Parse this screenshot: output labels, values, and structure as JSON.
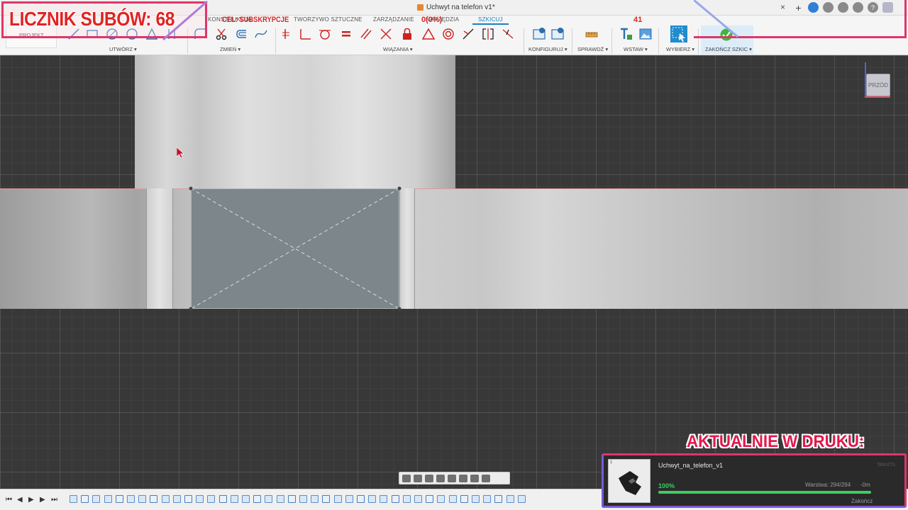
{
  "document": {
    "title": "Uchwyt na telefon v1*",
    "close_glyph": "×"
  },
  "ribbon": {
    "project_label": "PROJEKT",
    "tabs": [
      {
        "label": "KONSTRUKCJA"
      },
      {
        "label": "TWORZYWO SZTUCZNE"
      },
      {
        "label": "ZARZĄDZANIE"
      },
      {
        "label": "NARZĘDZIA"
      },
      {
        "label": "SZKICUJ",
        "active": true
      }
    ],
    "groups": {
      "create": "UTWÓRZ",
      "modify": "ZMIEŃ",
      "constraints": "WIĄZANIA",
      "configure": "KONFIGURUJ",
      "inspect": "SPRAWDŹ",
      "insert": "WSTAW",
      "select": "WYBIERZ",
      "finish_sketch": "ZAKOŃCZ SZKIC"
    }
  },
  "viewcube": {
    "face": "PRZÓD"
  },
  "overlay": {
    "sub_counter": "LICZNIK SUBÓW: 68",
    "goal_label": "CEL: SUBSKRYPCJE",
    "goal_progress": "0(0%)",
    "goal_count": "41",
    "printing_title": "AKTUALNIE W DRUKU:"
  },
  "print_job": {
    "thumb_index": "1",
    "name": "Uchwyt_na_telefon_v1",
    "elapsed": "50m27s",
    "percent_label": "100%",
    "progress": 1.0,
    "layer": "Warstwa: 294/294",
    "remaining": "-0m",
    "finish_label": "Zakończ"
  },
  "colors": {
    "accent": "#1a7fc1",
    "overlay_pink": "#e0356a",
    "overlay_red": "#e02424",
    "progress_green": "#3ccf5e"
  }
}
